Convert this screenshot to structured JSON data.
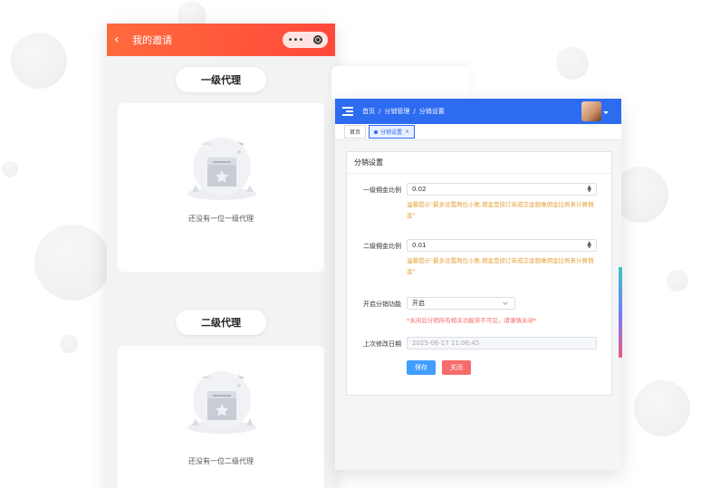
{
  "phone": {
    "title": "我的邀请",
    "back_icon": "chevron-left-icon",
    "capsule_more": "•••",
    "levels": [
      {
        "label": "一级代理",
        "empty_text": "还没有一位一级代理"
      },
      {
        "label": "二级代理",
        "empty_text": "还没有一位二级代理"
      }
    ]
  },
  "admin": {
    "breadcrumb": [
      "首页",
      "/",
      "分销管理",
      "/",
      "分销设置"
    ],
    "tabs": [
      {
        "label": "首页"
      },
      {
        "label": "分销设置",
        "close": "×"
      }
    ],
    "form": {
      "title": "分销设置",
      "level1": {
        "label": "一级佣金比例",
        "value": "0.02",
        "hint": "温馨提示\"最多设置两位小数,佣金是按订单成交金额乘佣金比例来计算佣金\""
      },
      "level2": {
        "label": "二级佣金比例",
        "value": "0.01",
        "hint": "温馨提示\"最多设置两位小数,佣金是按订单成交金额乘佣金比例来计算佣金\""
      },
      "toggle": {
        "label": "开启分销功能",
        "value": "开启",
        "warning": "*关闭后分销所有相关功能将不可见，请谨慎关闭*"
      },
      "last_modified": {
        "label": "上次修改日期",
        "value": "2025-06-17 11:06:45"
      },
      "save_label": "保存",
      "close_label": "关闭"
    }
  },
  "colors": {
    "phone_header": "#ff5a3a",
    "admin_header": "#2d6cf0",
    "hint": "#e6a23c",
    "warning": "#f56c6c",
    "primary_button": "#409eff",
    "danger_button": "#f56c6c"
  }
}
